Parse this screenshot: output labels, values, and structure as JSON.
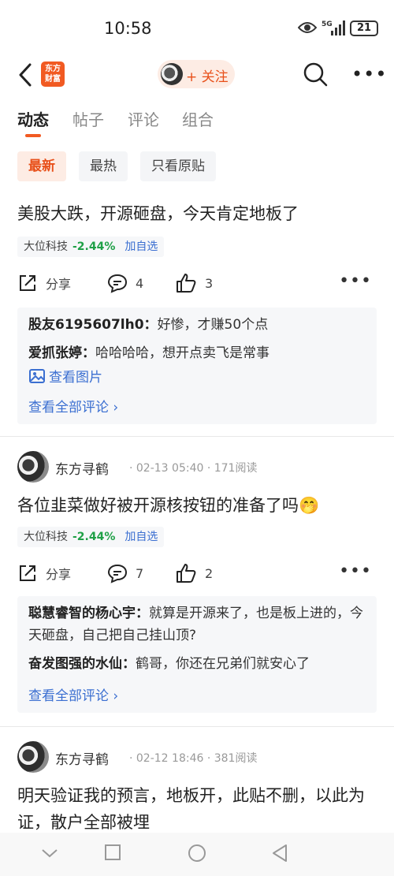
{
  "status": {
    "time": "10:58",
    "battery": "21",
    "network": "5G"
  },
  "header": {
    "logo_text_1": "东方",
    "logo_text_2": "财富",
    "follow_label": "+ 关注"
  },
  "tabs": [
    {
      "label": "动态",
      "active": true
    },
    {
      "label": "帖子"
    },
    {
      "label": "评论"
    },
    {
      "label": "组合"
    }
  ],
  "filters": [
    {
      "label": "最新",
      "active": true
    },
    {
      "label": "最热"
    },
    {
      "label": "只看原贴"
    }
  ],
  "posts": [
    {
      "content": "美股大跌，开源砸盘，今天肯定地板了",
      "stock": {
        "name": "大位科技",
        "change": "-2.44%",
        "add": "加自选"
      },
      "share": "分享",
      "comments": "4",
      "likes": "3",
      "comment_list": [
        {
          "user": "股友6195607lh0：",
          "text": "好惨，才赚50个点"
        },
        {
          "user": "爱抓张婷：",
          "text": "哈哈哈哈，想开点卖飞是常事"
        }
      ],
      "view_image": "查看图片",
      "view_all": "查看全部评论 ›"
    },
    {
      "author": "东方寻鹤",
      "meta": "· 02-13 05:40 · 171阅读",
      "content": "各位韭菜做好被开源核按钮的准备了吗🤭",
      "stock": {
        "name": "大位科技",
        "change": "-2.44%",
        "add": "加自选"
      },
      "share": "分享",
      "comments": "7",
      "likes": "2",
      "comment_list": [
        {
          "user": "聪慧睿智的杨心宇：",
          "text": "就算是开源来了，也是板上进的，今天砸盘，自己把自己挂山顶?"
        },
        {
          "user": "奋发图强的水仙：",
          "text": "鹤哥，你还在兄弟们就安心了"
        }
      ],
      "view_all": "查看全部评论 ›"
    },
    {
      "author": "东方寻鹤",
      "meta": "· 02-12 18:46 · 381阅读",
      "content": "明天验证我的预言，地板开，此贴不删，以此为证，散户全部被埋"
    }
  ]
}
